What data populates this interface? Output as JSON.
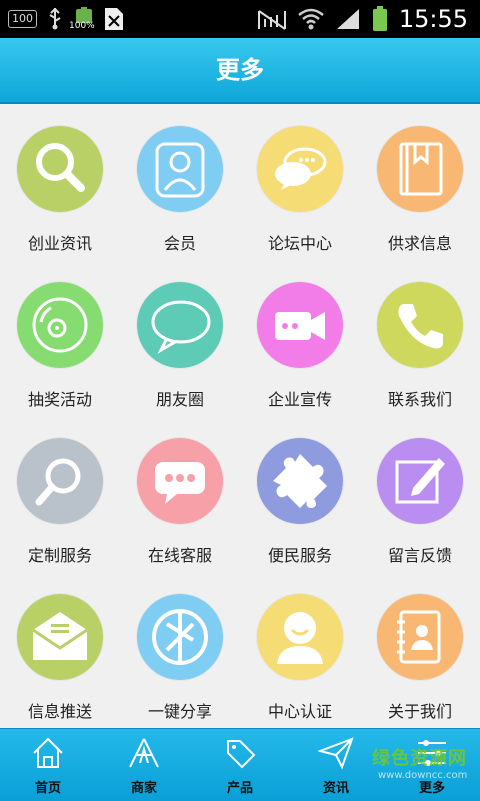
{
  "status_bar": {
    "box_label": "100",
    "battery_small_label": "100%",
    "time": "15:55"
  },
  "header": {
    "title": "更多"
  },
  "colors": {
    "header": "#1bb4e4",
    "green": "#b9d067",
    "blue": "#7fcdf2",
    "yellow": "#f6dc75",
    "orange": "#f8b873",
    "mint": "#86dc71",
    "teal": "#5ecbb6",
    "pink": "#f37de8",
    "olive": "#cdd85c",
    "gray": "#b9c1ca",
    "rose": "#f7a0a8",
    "violet": "#8e9bdf",
    "purple": "#ba8df0"
  },
  "grid": {
    "items": [
      {
        "label": "创业资讯",
        "icon": "search-icon",
        "color": "#b9d067"
      },
      {
        "label": "会员",
        "icon": "user-icon",
        "color": "#7fcdf2"
      },
      {
        "label": "论坛中心",
        "icon": "chat-icon",
        "color": "#f6dc75"
      },
      {
        "label": "供求信息",
        "icon": "book-icon",
        "color": "#f8b873"
      },
      {
        "label": "抽奖活动",
        "icon": "disc-icon",
        "color": "#86dc71"
      },
      {
        "label": "朋友圈",
        "icon": "speech-bubble-icon",
        "color": "#5ecbb6"
      },
      {
        "label": "企业宣传",
        "icon": "video-camera-icon",
        "color": "#f37de8"
      },
      {
        "label": "联系我们",
        "icon": "phone-icon",
        "color": "#cdd85c"
      },
      {
        "label": "定制服务",
        "icon": "magnifier-icon",
        "color": "#b9c1ca"
      },
      {
        "label": "在线客服",
        "icon": "message-icon",
        "color": "#f7a0a8"
      },
      {
        "label": "便民服务",
        "icon": "puzzle-icon",
        "color": "#8e9bdf"
      },
      {
        "label": "留言反馈",
        "icon": "edit-icon",
        "color": "#ba8df0"
      },
      {
        "label": "信息推送",
        "icon": "envelope-icon",
        "color": "#b9d067"
      },
      {
        "label": "一键分享",
        "icon": "share-icon",
        "color": "#7fcdf2"
      },
      {
        "label": "中心认证",
        "icon": "person-icon",
        "color": "#f6dc75"
      },
      {
        "label": "关于我们",
        "icon": "contacts-icon",
        "color": "#f8b873"
      }
    ]
  },
  "bottom_nav": {
    "items": [
      {
        "label": "首页",
        "icon": "home-icon"
      },
      {
        "label": "商家",
        "icon": "shop-icon"
      },
      {
        "label": "产品",
        "icon": "tag-icon"
      },
      {
        "label": "资讯",
        "icon": "paper-plane-icon"
      },
      {
        "label": "更多",
        "icon": "sliders-icon"
      }
    ],
    "watermark": "绿色资源网",
    "watermark_sub": "www.downcc.com"
  }
}
